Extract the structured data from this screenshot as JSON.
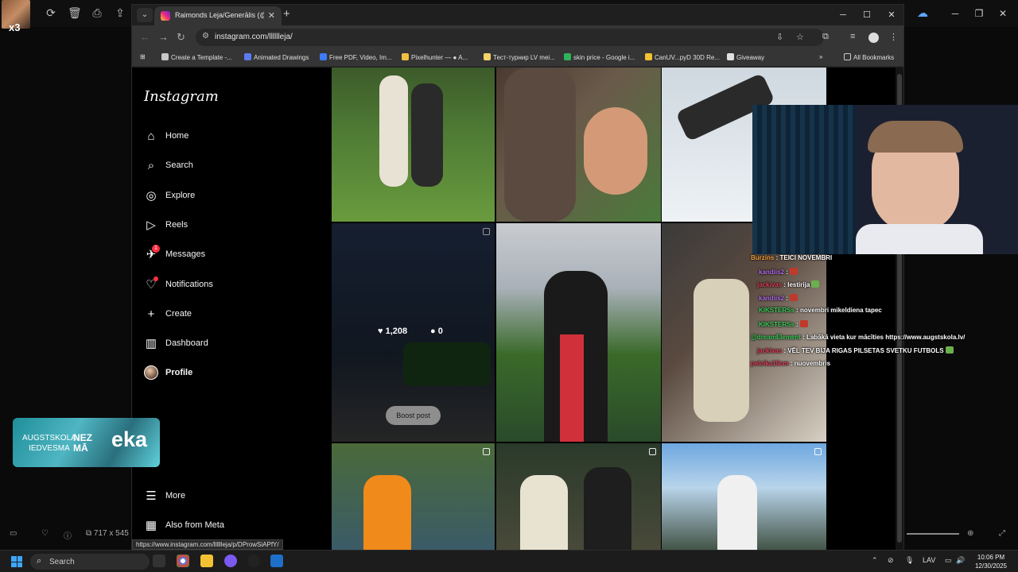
{
  "browser": {
    "tab_title": "Raimonds Leja/Generālis (@lllll",
    "url": "instagram.com/lllllleja/",
    "bookmarks": [
      {
        "label": "Create a Template -...",
        "color": "#c9c9c9"
      },
      {
        "label": "Animated Drawings",
        "color": "#5b7cf0"
      },
      {
        "label": "Free PDF, Video, Im...",
        "color": "#3d7bf7"
      },
      {
        "label": "Pixelhunter — ● A...",
        "color": "#f0c040"
      },
      {
        "label": "Тест-турнир LV mei...",
        "color": "#f5d36a"
      },
      {
        "label": "skin price - Google i...",
        "color": "#2eb35a"
      },
      {
        "label": "CanUV...pyD 30D Re...",
        "color": "#f1c232"
      },
      {
        "label": "Giveaway",
        "color": "#e0e0e0"
      }
    ],
    "all_bookmarks": "All Bookmarks",
    "status_url": "https://www.instagram.com/lllllleja/p/DProwSiAPfY/"
  },
  "instagram": {
    "logo": "Instagram",
    "nav": [
      {
        "label": "Home",
        "icon": "home-icon"
      },
      {
        "label": "Search",
        "icon": "search-icon"
      },
      {
        "label": "Explore",
        "icon": "explore-icon"
      },
      {
        "label": "Reels",
        "icon": "reels-icon"
      },
      {
        "label": "Messages",
        "icon": "messages-icon",
        "badge": "1"
      },
      {
        "label": "Notifications",
        "icon": "heart-icon"
      },
      {
        "label": "Create",
        "icon": "plus-icon"
      },
      {
        "label": "Dashboard",
        "icon": "dashboard-icon"
      },
      {
        "label": "Profile",
        "icon": "avatar"
      }
    ],
    "more": "More",
    "also_from_meta": "Also from Meta",
    "hovered_post": {
      "likes": "1,208",
      "comments": "0",
      "boost": "Boost post"
    }
  },
  "chat": [
    {
      "user": "Burzins",
      "user_color": "#f0a040",
      "text": ": TEICI NOVEMBRI"
    },
    {
      "user": "kandiis2",
      "user_color": "#b06ee8",
      "text": ":"
    },
    {
      "user": "jackivas",
      "user_color": "#e0405a",
      "text": ": Iestirija"
    },
    {
      "user": "kandiis2",
      "user_color": "#b06ee8",
      "text": ":"
    },
    {
      "user": "KIKSTERSs",
      "user_color": "#3ccc5a",
      "text": ": novembri mikeldiena tapec"
    },
    {
      "user": "KIKSTERSs",
      "user_color": "#3ccc5a",
      "text": ":"
    },
    {
      "user": "@dreamElement",
      "user_color": "#3ccc5a",
      "text": ": Labākā vieta kur mācīties https://www.augstskola.lv/"
    },
    {
      "user": "jackivas",
      "user_color": "#e0405a",
      "text": ": VĒL TEV BIJA RIGAS PILSETAS SVETKU FUTBOLS"
    },
    {
      "user": "pelcika19cm",
      "user_color": "#e0405a",
      "text": ": nuovembris"
    }
  ],
  "logo_card": {
    "left": "AUGSTSKOLA\nIEDVESMA",
    "mid": "NEZ\nMĀ",
    "right": "eka"
  },
  "outer": {
    "streamer_badge": "x3",
    "dimensions": "717 x 545"
  },
  "taskbar": {
    "search": "Search",
    "lang": "LAV",
    "time": "10:06 PM",
    "date": "12/30/2025"
  }
}
